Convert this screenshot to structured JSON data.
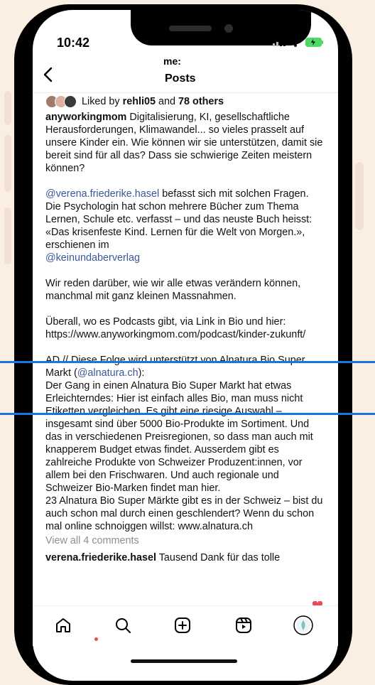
{
  "colors": {
    "background": "#fbeee3",
    "link": "#385898",
    "muted": "#8e8e8e",
    "accent": "#1b74e4",
    "badge": "#ed4956"
  },
  "status": {
    "time": "10:42"
  },
  "header": {
    "username": "me:",
    "title": "Posts",
    "back_icon": "chevron-left-icon"
  },
  "post": {
    "liked_prefix": "Liked by ",
    "liked_user": "rehli05",
    "liked_mid": " and ",
    "liked_others": "78 others",
    "author": "anyworkingmom",
    "caption_1": " Digitalisierung, KI, gesellschaftliche Herausforderungen, Klimawandel... so vieles prasselt auf unsere Kinder ein. Wie können wir sie unterstützen, damit sie bereit sind für all das? Dass sie schwierige Zeiten meistern können?",
    "mention_1": "@verena.friederike.hasel",
    "caption_2": " befasst sich mit solchen Fragen. Die Psychologin hat schon mehrere Bücher zum Thema Lernen, Schule etc. verfasst – und das neuste Buch heisst: «Das krisenfeste Kind. Lernen für die Welt von Morgen.», erschienen im",
    "mention_2": "@keinundaberverlag",
    "caption_3": "Wir reden darüber, wie wir alle etwas verändern können, manchmal mit ganz kleinen Massnahmen.",
    "caption_4": "Überall, wo es Podcasts gibt, via Link in Bio und hier: https://www.anyworkingmom.com/podcast/kinder-zukunft/",
    "caption_5a": "AD // Diese Folge wird unterstützt von Alnatura Bio Super Markt (",
    "mention_3": "@alnatura.ch",
    "caption_5b": "):",
    "caption_6": "Der Gang in einen Alnatura Bio Super Markt hat etwas Erleichterndes: Hier ist einfach alles Bio, man muss nicht Etiketten vergleichen. Es gibt eine riesige Auswahl – insgesamt sind über 5000 Bio-Produkte im Sortiment. Und das in verschiedenen Preisregionen, so dass man auch mit knapperem Budget etwas findet. Ausserdem gibt es zahlreiche Produkte von Schweizer Produzent:innen, vor allem bei den Frischwaren. Und auch regionale und Schweizer Bio-Marken findet man hier.",
    "caption_7": "23 Alnatura Bio Super Märkte gibt es in der Schweiz – bist du auch schon mal durch einen geschlendert? Wenn du schon mal online schnoiggen willst: www.alnatura.ch",
    "view_comments": "View all 4 comments",
    "comment_user": "verena.friederike.hasel",
    "comment_text": " Tausend Dank für das tolle"
  },
  "tabbar": {
    "icons": [
      "home-icon",
      "search-icon",
      "create-icon",
      "reels-icon",
      "profile-icon"
    ]
  }
}
